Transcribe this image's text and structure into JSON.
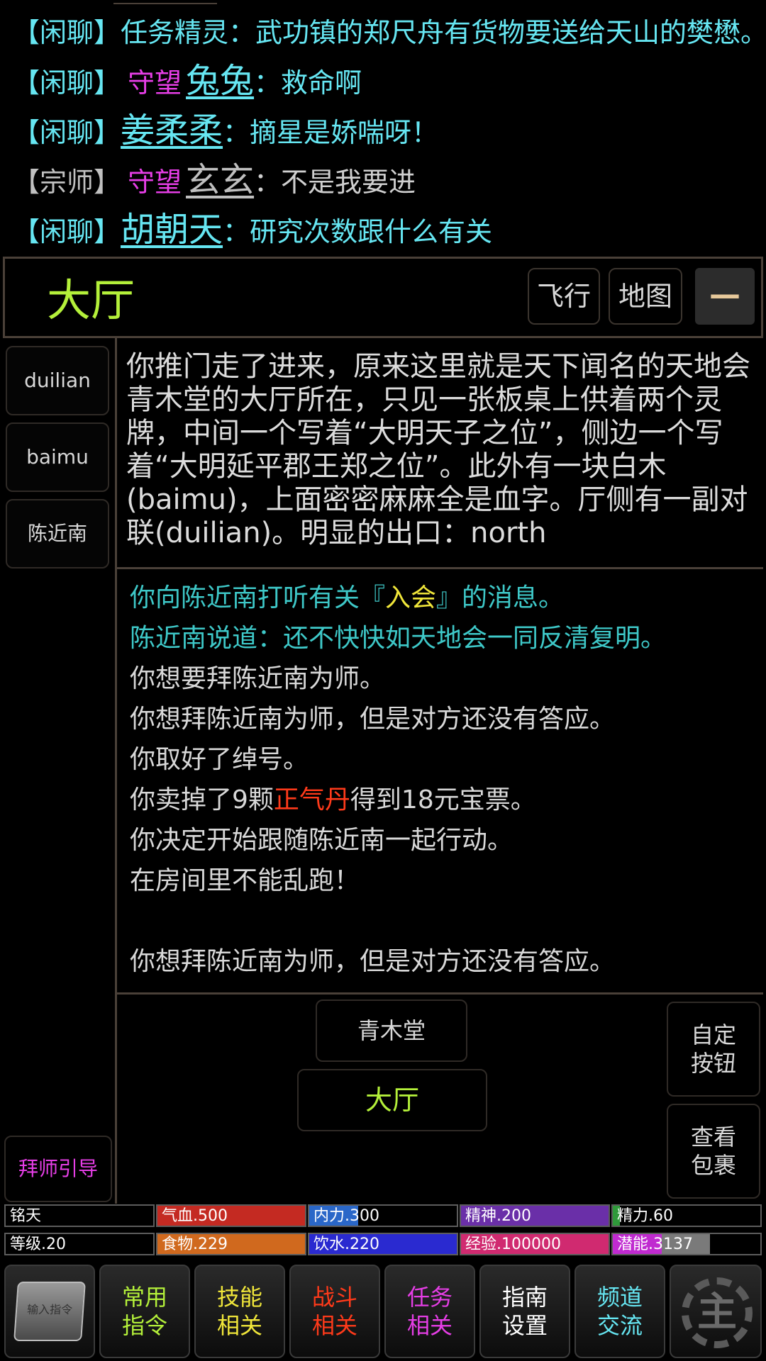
{
  "chat": [
    {
      "tag": "【闲聊】",
      "prefix": "",
      "name": "",
      "msg": "任务精灵：武功镇的郑尺舟有货物要送给天山的樊懋。",
      "gray": false
    },
    {
      "tag": "【闲聊】",
      "prefix": "守望",
      "name": "兔兔",
      "msg": "：救命啊",
      "gray": false
    },
    {
      "tag": "【闲聊】",
      "prefix": "",
      "name": "姜柔柔",
      "msg": "：摘星是娇喘呀！",
      "gray": false
    },
    {
      "tag": "【宗师】",
      "prefix": "守望",
      "name": "玄玄",
      "msg": "：不是我要进",
      "gray": true
    },
    {
      "tag": "【闲聊】",
      "prefix": "",
      "name": "胡朝天",
      "msg": "：研究次数跟什么有关",
      "gray": false
    }
  ],
  "room": {
    "title": "大厅",
    "fly_label": "飞行",
    "map_label": "地图",
    "collapse_label": "—"
  },
  "objects": [
    "duilian",
    "baimu",
    "陈近南"
  ],
  "description": "你推门走了进来，原来这里就是天下闻名的天地会青木堂的大厅所在，只见一张板桌上供着两个灵牌，中间一个写着“大明天子之位”，侧边一个写着“大明延平郡王郑之位”。此外有一块白木(baimu)，上面密密麻麻全是血字。厅侧有一副对联(duilian)。明显的出口：north",
  "log": {
    "l1_a": "你向陈近南打听有关『",
    "l1_b": "入会",
    "l1_c": "』的消息。",
    "l2": "陈近南说道：还不快快如天地会一同反清复明。",
    "l3": "你想要拜陈近南为师。",
    "l4": "你想拜陈近南为师，但是对方还没有答应。",
    "l5": "你取好了绰号。",
    "l6_a": "你卖掉了9颗",
    "l6_b": "正气丹",
    "l6_c": "得到18元宝票。",
    "l7": "你决定开始跟随陈近南一起行动。",
    "l8": "在房间里不能乱跑！",
    "l9": "你想拜陈近南为师，但是对方还没有答应。"
  },
  "exits": {
    "north": "青木堂",
    "current": "大厅"
  },
  "side_buttons": {
    "custom_l1": "自定",
    "custom_l2": "按钮",
    "bag_l1": "查看",
    "bag_l2": "包裹"
  },
  "guide_label": "拜师引导",
  "stats": [
    {
      "key": "name",
      "label": "铭天",
      "fill": 0,
      "color": "#000000"
    },
    {
      "key": "hp",
      "label": "气血.500",
      "fill": 1.0,
      "color": "#c42a22"
    },
    {
      "key": "mp",
      "label": "内力.300",
      "fill": 0.33,
      "color": "#2a67c8"
    },
    {
      "key": "spirit",
      "label": "精神.200",
      "fill": 1.0,
      "color": "#6a2fa8"
    },
    {
      "key": "energy",
      "label": "精力.60",
      "fill": 0.05,
      "color": "#2f9a3a"
    },
    {
      "key": "level",
      "label": "等级.20",
      "fill": 0,
      "color": "#000000"
    },
    {
      "key": "food",
      "label": "食物.229",
      "fill": 1.0,
      "color": "#d0691e"
    },
    {
      "key": "water",
      "label": "饮水.220",
      "fill": 1.0,
      "color": "#2a2ad0"
    },
    {
      "key": "exp",
      "label": "经验.100000",
      "fill": 1.0,
      "color": "#d02a70"
    },
    {
      "key": "pot",
      "label": "潜能.3137",
      "fill": 0.33,
      "color": "#c02ad0",
      "rest_color": "#7a7a7a",
      "rest_fill": 0.33
    }
  ],
  "menu": {
    "input_icon_label": "输入指令",
    "common_l1": "常用",
    "common_l2": "指令",
    "skill_l1": "技能",
    "skill_l2": "相关",
    "fight_l1": "战斗",
    "fight_l2": "相关",
    "task_l1": "任务",
    "task_l2": "相关",
    "guide_l1": "指南",
    "guide_l2": "设置",
    "chan_l1": "频道",
    "chan_l2": "交流",
    "main_icon_label": "主"
  },
  "colors": {
    "accent_green": "#b4f03a",
    "cyan": "#66e6f2",
    "magenta": "#e63ee6",
    "red": "#ff3a1a",
    "yellow": "#f0e63a"
  }
}
